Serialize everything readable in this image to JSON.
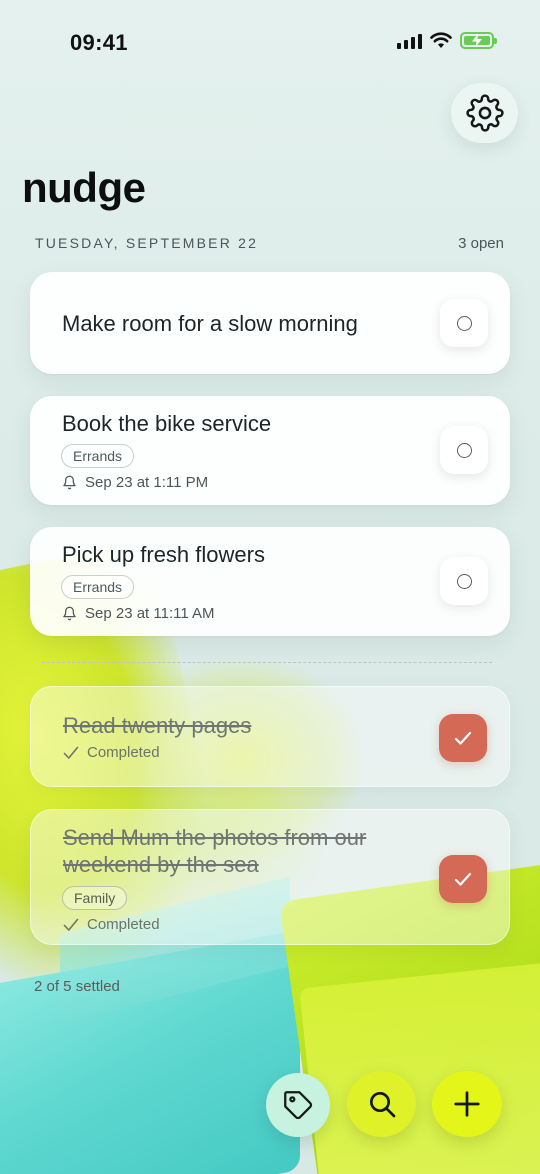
{
  "status_bar": {
    "time": "09:41",
    "icons": [
      "signal-icon",
      "wifi-icon",
      "battery-charging-icon"
    ]
  },
  "header": {
    "app_title": "nudge",
    "settings_icon": "gear-icon",
    "date": "TUESDAY, SEPTEMBER 22",
    "open_count": "3 open"
  },
  "tasks": [
    {
      "title": "Make room for a slow morning",
      "completed": false
    },
    {
      "title": "Book the bike service",
      "tag": "Errands",
      "reminder": "Sep 23 at 1:11 PM",
      "completed": false
    },
    {
      "title": "Pick up fresh flowers",
      "tag": "Errands",
      "reminder": "Sep 23 at 11:11 AM",
      "completed": false
    }
  ],
  "completed_tasks": [
    {
      "title": "Read twenty pages",
      "status": "Completed",
      "completed": true
    },
    {
      "title_line1": "Send Mum the photos from our",
      "title_line2": "weekend by the sea",
      "tag": "Family",
      "status": "Completed",
      "completed": true
    }
  ],
  "footer": {
    "settled": "2 of 5 settled"
  },
  "actions": {
    "tag_icon": "tag-icon",
    "search_icon": "search-icon",
    "add_icon": "plus-icon"
  },
  "colors": {
    "accent_lime": "#e4f619",
    "check_done": "#d46a55",
    "tag_button": "#c8f2e0"
  }
}
